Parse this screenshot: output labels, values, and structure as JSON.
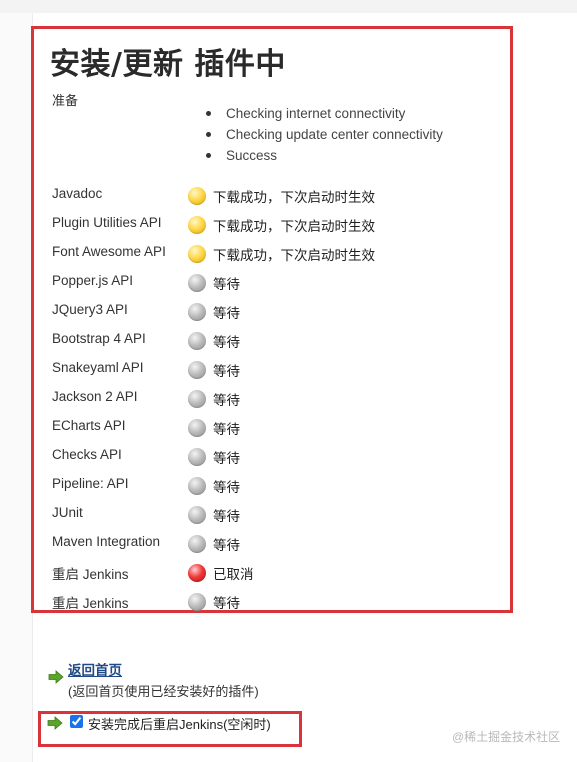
{
  "page_title": "安装/更新 插件中",
  "prepare_label": "准备",
  "checks": [
    "Checking internet connectivity",
    "Checking update center connectivity",
    "Success"
  ],
  "plugins": [
    {
      "name": "Javadoc",
      "status": "下载成功，下次启动时生效",
      "state": "yellow"
    },
    {
      "name": "Plugin Utilities API",
      "status": "下载成功，下次启动时生效",
      "state": "yellow"
    },
    {
      "name": "Font Awesome API",
      "status": "下载成功，下次启动时生效",
      "state": "yellow"
    },
    {
      "name": "Popper.js API",
      "status": "等待",
      "state": "grey"
    },
    {
      "name": "JQuery3 API",
      "status": "等待",
      "state": "grey"
    },
    {
      "name": "Bootstrap 4 API",
      "status": "等待",
      "state": "grey"
    },
    {
      "name": "Snakeyaml API",
      "status": "等待",
      "state": "grey"
    },
    {
      "name": "Jackson 2 API",
      "status": "等待",
      "state": "grey"
    },
    {
      "name": "ECharts API",
      "status": "等待",
      "state": "grey"
    },
    {
      "name": "Checks API",
      "status": "等待",
      "state": "grey"
    },
    {
      "name": "Pipeline: API",
      "status": "等待",
      "state": "grey"
    },
    {
      "name": "JUnit",
      "status": "等待",
      "state": "grey"
    },
    {
      "name": "Maven Integration",
      "status": "等待",
      "state": "grey"
    },
    {
      "name": "重启 Jenkins",
      "status": "已取消",
      "state": "red"
    },
    {
      "name": "重启 Jenkins",
      "status": "等待",
      "state": "grey"
    }
  ],
  "back": {
    "link_text": "返回首页",
    "description": "(返回首页使用已经安装好的插件)"
  },
  "restart": {
    "label": "安装完成后重启Jenkins(空闲时)",
    "checked": true
  },
  "watermark": "@稀土掘金技术社区",
  "colors": {
    "highlight_border": "#d9343a",
    "link": "#204a87",
    "arrow": "#5aa428"
  }
}
